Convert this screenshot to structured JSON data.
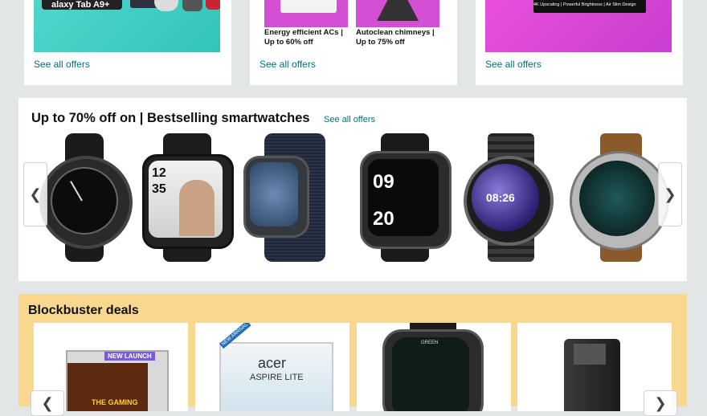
{
  "top_cards": [
    {
      "see_all": "See all offers",
      "image_text": "alaxy Tab A9+"
    },
    {
      "see_all": "See all offers",
      "captions": [
        "Energy efficient ACs | Up to 60% off",
        "Autoclean chimneys | Up to 75% off"
      ]
    },
    {
      "see_all": "See all offers",
      "image_text": "4K Upscaling | Powerful Brightness | Air Slim Design"
    }
  ],
  "smartwatches": {
    "title": "Up to 70% off on | Bestselling smartwatches",
    "see_all": "See all offers",
    "prev_icon": "chevron-left-icon",
    "next_icon": "chevron-right-icon",
    "watches": [
      {
        "name": "samsung-round-watch",
        "face": ""
      },
      {
        "name": "fireboltt-dhoni-watch",
        "face": "12 35"
      },
      {
        "name": "apple-watch-navy-loop",
        "face": ""
      },
      {
        "name": "noise-square-watch",
        "face": "09 20"
      },
      {
        "name": "fastrack-steel-watch",
        "face": "08:26"
      },
      {
        "name": "fossil-brown-strap-watch",
        "face": ""
      }
    ]
  },
  "blockbuster": {
    "title": "Blockbuster deals",
    "tiles": [
      {
        "badge": "NEW LAUNCH",
        "text": "THE GAMING"
      },
      {
        "badge": "NEW ARRIVAL",
        "text": "acer",
        "sub": "ASPIRE LITE"
      },
      {
        "text": "GREEN"
      },
      {
        "text": ""
      }
    ]
  }
}
